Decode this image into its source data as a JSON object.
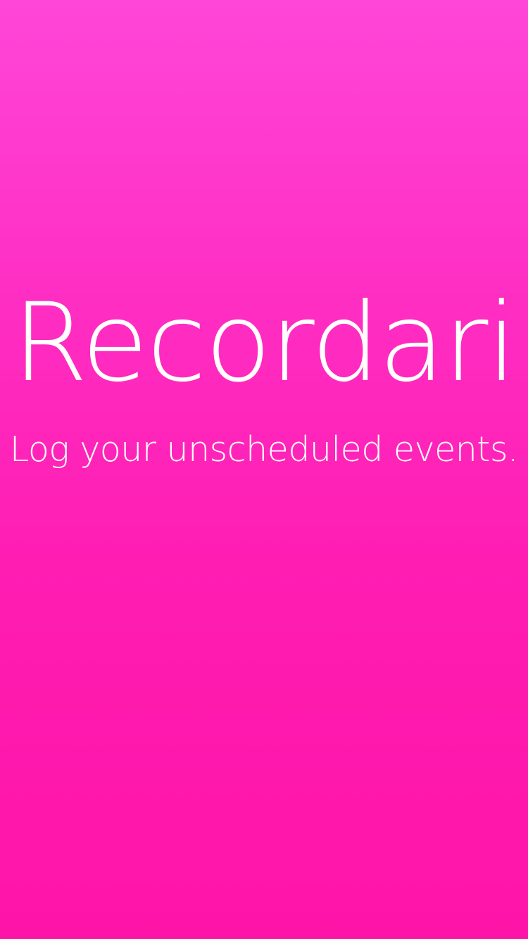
{
  "app": {
    "title": "Recordari",
    "tagline": "Log your unscheduled events."
  },
  "colors": {
    "gradient_top": "#ff46d8",
    "gradient_bottom": "#ff14a8",
    "text": "#ffffff"
  }
}
